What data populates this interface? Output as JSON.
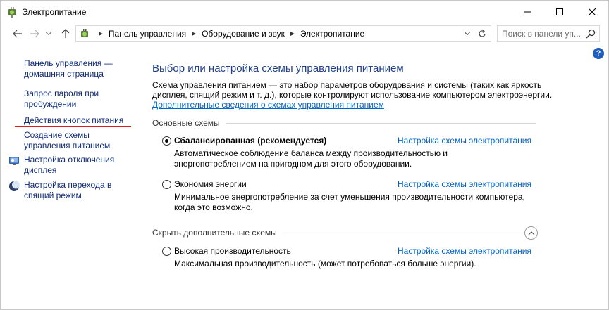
{
  "window": {
    "title": "Электропитание"
  },
  "address": {
    "crumbs": [
      "Панель управления",
      "Оборудование и звук",
      "Электропитание"
    ],
    "search_placeholder": "Поиск в панели уп..."
  },
  "sidebar": {
    "items": [
      {
        "label": "Панель управления — домашняя страница"
      },
      {
        "label": "Запрос пароля при пробуждении"
      },
      {
        "label": "Действия кнопок питания"
      },
      {
        "label": "Создание схемы управления питанием"
      },
      {
        "label": "Настройка отключения дисплея"
      },
      {
        "label": "Настройка перехода в спящий режим"
      }
    ]
  },
  "main": {
    "title": "Выбор или настройка схемы управления питанием",
    "description": "Схема управления питанием — это набор параметров оборудования и системы (таких как яркость дисплея, спящий режим и т. д.), которые контролируют использование компьютером электроэнергии.",
    "more_link": "Дополнительные сведения о схемах управления питанием",
    "section_main": "Основные схемы",
    "section_hidden": "Скрыть дополнительные схемы",
    "schemes": [
      {
        "name": "Сбалансированная (рекомендуется)",
        "checked": true,
        "link": "Настройка схемы электропитания",
        "description": "Автоматическое соблюдение баланса между производительностью и энергопотреблением на пригодном для этого оборудовании."
      },
      {
        "name": "Экономия энергии",
        "checked": false,
        "link": "Настройка схемы электропитания",
        "description": "Минимальное энергопотребление за счет уменьшения производительности компьютера, когда это возможно."
      },
      {
        "name": "Высокая производительность",
        "checked": false,
        "link": "Настройка схемы электропитания",
        "description": "Максимальная производительность (может потребоваться больше энергии)."
      }
    ]
  },
  "icons": {
    "app": "power-options-icon",
    "help": "help-icon"
  },
  "colors": {
    "link": "#0066cc",
    "title": "#1e3f8a",
    "accent_underline": "#e01b1b"
  },
  "help_label": "?"
}
